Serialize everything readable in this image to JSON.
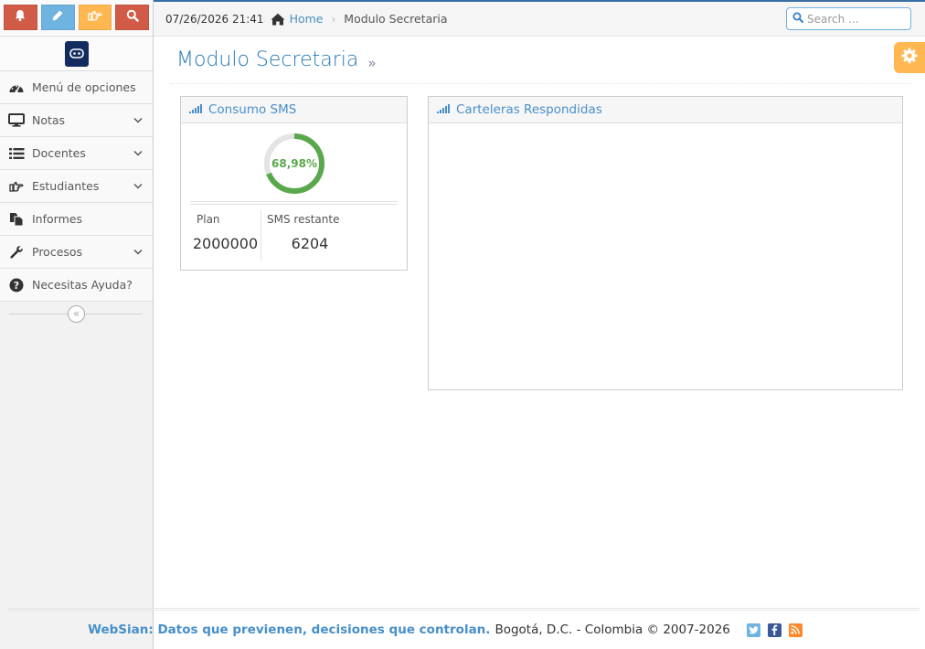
{
  "colors": {
    "bell_button": "#d15b47",
    "pencil_button": "#6fb3e0",
    "hand_button": "#ffb752",
    "search_button": "#d15b47",
    "accent": "#478fca",
    "donut_fill": "#59a84b",
    "settings": "#ffb752"
  },
  "shortcuts": [
    {
      "icon": "bell-icon"
    },
    {
      "icon": "pencil-icon"
    },
    {
      "icon": "hand-point-right-icon"
    },
    {
      "icon": "search-icon"
    }
  ],
  "sidebar": {
    "items": [
      {
        "label": "Menú de opciones",
        "icon": "dashboard-icon",
        "has_submenu": false
      },
      {
        "label": "Notas",
        "icon": "desktop-icon",
        "has_submenu": true
      },
      {
        "label": "Docentes",
        "icon": "list-icon",
        "has_submenu": true
      },
      {
        "label": "Estudiantes",
        "icon": "hand-point-right-icon",
        "has_submenu": true
      },
      {
        "label": "Informes",
        "icon": "files-icon",
        "has_submenu": false
      },
      {
        "label": "Procesos",
        "icon": "wrench-icon",
        "has_submenu": true
      },
      {
        "label": "Necesitas Ayuda?",
        "icon": "question-circle-icon",
        "has_submenu": false
      }
    ],
    "collapse_glyph": "«"
  },
  "topbar": {
    "datetime": "07/26/2026 21:41",
    "home_label": "Home",
    "separator": "›",
    "current": "Modulo Secretaria",
    "search_placeholder": "Search ..."
  },
  "page": {
    "title": "Modulo Secretaria",
    "title_suffix": "»"
  },
  "sms_widget": {
    "title": "Consumo SMS",
    "percent_text": "68,98%",
    "percent_value": 68.98,
    "plan_label": "Plan",
    "plan_value": "2000000",
    "remaining_label": "SMS restante",
    "remaining_value": "6204"
  },
  "carteleras_widget": {
    "title": "Carteleras Respondidas"
  },
  "footer": {
    "brand": "WebSian: Datos que previenen, decisiones que controlan.",
    "rest": "Bogotá, D.C. - Colombia © 2007-2026",
    "icons": [
      "twitter-icon",
      "facebook-icon",
      "rss-icon"
    ]
  }
}
